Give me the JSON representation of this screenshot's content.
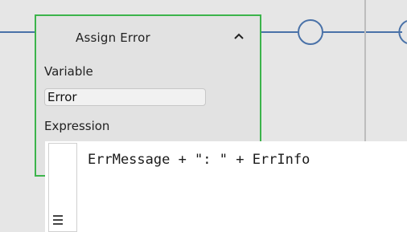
{
  "node": {
    "title": "Assign Error",
    "collapse_icon": "chevron-up-icon"
  },
  "variable": {
    "label": "Variable",
    "value": "Error"
  },
  "expression": {
    "label": "Expression",
    "value": "ErrMessage + \": \" + ErrInfo"
  },
  "colors": {
    "node_border": "#3cb44b",
    "connector": "#4a72a8",
    "canvas": "#e6e6e6"
  }
}
